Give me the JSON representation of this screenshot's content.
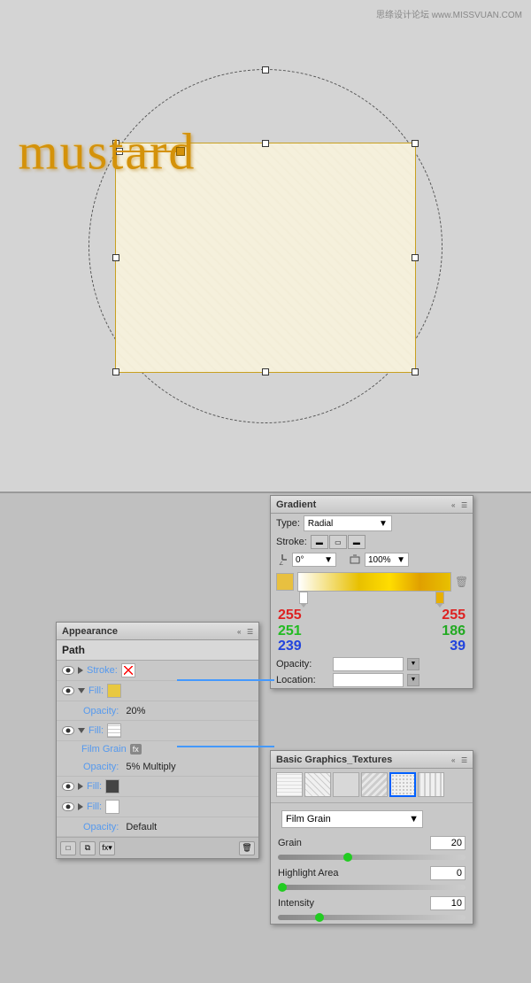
{
  "watermark": {
    "text": "思绦设计论坛  www.MISSVUAN.COM"
  },
  "canvas": {
    "mustard_text": "mustard"
  },
  "appearance_panel": {
    "title": "Appearance",
    "path_label": "Path",
    "rows": [
      {
        "type": "stroke",
        "label": "Stroke:",
        "swatch": "red-x"
      },
      {
        "type": "fill",
        "label": "Fill:",
        "swatch": "yellow",
        "expanded": true
      },
      {
        "type": "opacity",
        "label": "Opacity:",
        "value": "20%"
      },
      {
        "type": "fill2",
        "label": "Fill:",
        "swatch": "grid",
        "expanded": true
      },
      {
        "type": "film-grain",
        "label": "Film Grain",
        "fx": true
      },
      {
        "type": "opacity2",
        "label": "Opacity:",
        "value": "5% Multiply"
      },
      {
        "type": "fill3",
        "label": "Fill:",
        "swatch": "dark"
      },
      {
        "type": "fill4",
        "label": "Fill:",
        "swatch": "white"
      },
      {
        "type": "opacity3",
        "label": "Opacity:",
        "value": "Default"
      }
    ]
  },
  "gradient_panel": {
    "title": "Gradient",
    "type_label": "Type:",
    "type_value": "Radial",
    "stroke_label": "Stroke:",
    "angle_label": "0°",
    "scale_label": "100%",
    "left_color": {
      "r": "255",
      "g": "251",
      "b": "239"
    },
    "right_color": {
      "r": "255",
      "g": "186",
      "b": "39"
    },
    "opacity_label": "Opacity:",
    "location_label": "Location:"
  },
  "textures_panel": {
    "title": "Basic Graphics_Textures",
    "dropdown_label": "Film Grain",
    "params": [
      {
        "label": "Grain",
        "value": "20"
      },
      {
        "label": "Highlight Area",
        "value": "0"
      },
      {
        "label": "Intensity",
        "value": "10"
      }
    ]
  }
}
